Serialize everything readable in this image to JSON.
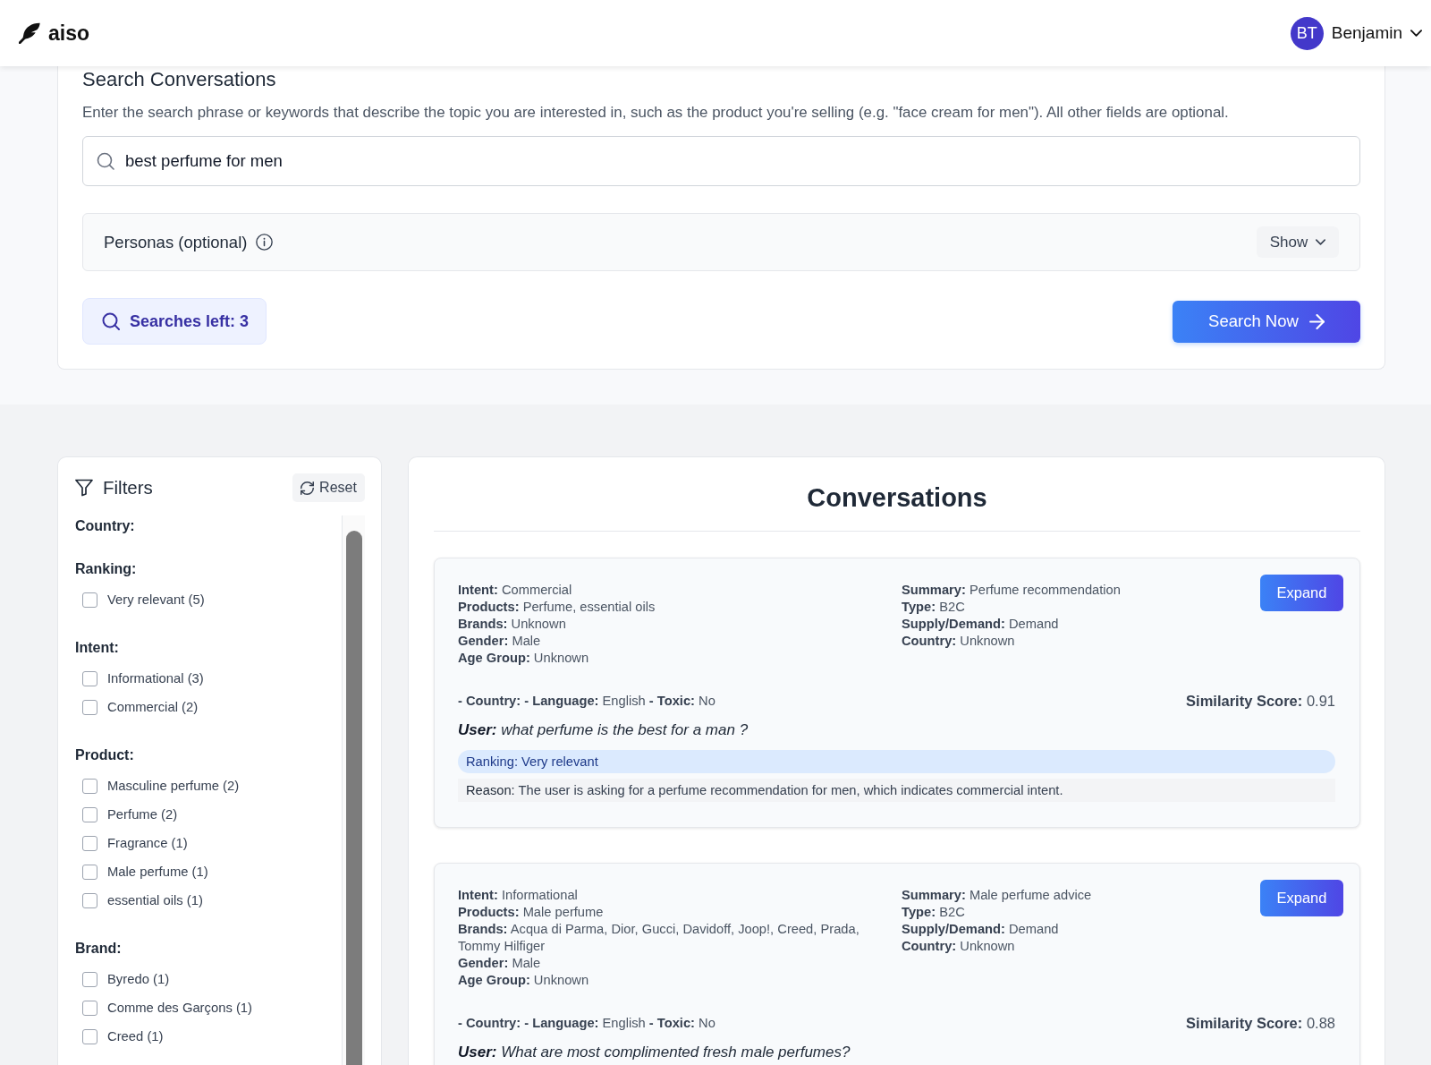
{
  "header": {
    "logo": "aiso",
    "user": {
      "initials": "BT",
      "name": "Benjamin"
    }
  },
  "search": {
    "title": "Search Conversations",
    "description": "Enter the search phrase or keywords that describe the topic you are interested in, such as the product you're selling (e.g. \"face cream for men\"). All other fields are optional.",
    "query": "best perfume for men",
    "personas": {
      "label": "Personas (optional)",
      "toggle": "Show",
      "expanded": false
    },
    "searches_left": "Searches left: 3",
    "submit": "Search Now"
  },
  "filters": {
    "title": "Filters",
    "reset": "Reset",
    "groups": [
      {
        "title": "Country:"
      },
      {
        "title": "Ranking:",
        "options": [
          {
            "label": "Very relevant (5)",
            "checked": false
          }
        ]
      },
      {
        "title": "Intent:",
        "options": [
          {
            "label": "Informational (3)",
            "checked": false
          },
          {
            "label": "Commercial (2)",
            "checked": false
          }
        ]
      },
      {
        "title": "Product:",
        "options": [
          {
            "label": "Masculine perfume (2)",
            "checked": false
          },
          {
            "label": "Perfume (2)",
            "checked": false
          },
          {
            "label": "Fragrance (1)",
            "checked": false
          },
          {
            "label": "Male perfume (1)",
            "checked": false
          },
          {
            "label": "essential oils (1)",
            "checked": false
          }
        ]
      },
      {
        "title": "Brand:",
        "options": [
          {
            "label": "Byredo (1)",
            "checked": false
          },
          {
            "label": "Comme des Garçons (1)",
            "checked": false
          },
          {
            "label": "Creed (1)",
            "checked": false
          }
        ]
      }
    ]
  },
  "conversations": {
    "title": "Conversations",
    "items": [
      {
        "details_left": [
          {
            "label": "Intent:",
            "value": "Commercial"
          },
          {
            "label": "Products:",
            "value": "Perfume, essential oils"
          },
          {
            "label": "Brands:",
            "value": "Unknown"
          },
          {
            "label": "Gender:",
            "value": "Male"
          },
          {
            "label": "Age Group:",
            "value": "Unknown"
          }
        ],
        "details_right": [
          {
            "label": "Summary:",
            "value": "Perfume recommendation"
          },
          {
            "label": "Type:",
            "value": "B2C"
          },
          {
            "label": "Supply/Demand:",
            "value": "Demand"
          },
          {
            "label": "Country:",
            "value": "Unknown"
          }
        ],
        "expand": "Expand",
        "meta": "**- Country: - Language:** English **- Toxic:** No",
        "similarity": {
          "label": "Similarity Score:",
          "value": "0.91"
        },
        "message": {
          "speaker": "User:",
          "text": "what perfume is the best for a man ?"
        },
        "ranking": "Ranking: Very relevant",
        "reason": {
          "label": "Reason:",
          "text": "The user is asking for a perfume recommendation for men, which indicates commercial intent."
        }
      },
      {
        "details_left": [
          {
            "label": "Intent:",
            "value": "Informational"
          },
          {
            "label": "Products:",
            "value": "Male perfume"
          },
          {
            "label": "Brands:",
            "value": "Acqua di Parma, Dior, Gucci, Davidoff, Joop!, Creed, Prada, Tommy Hilfiger"
          },
          {
            "label": "Gender:",
            "value": "Male"
          },
          {
            "label": "Age Group:",
            "value": "Unknown"
          }
        ],
        "details_right": [
          {
            "label": "Summary:",
            "value": "Male perfume advice"
          },
          {
            "label": "Type:",
            "value": "B2C"
          },
          {
            "label": "Supply/Demand:",
            "value": "Demand"
          },
          {
            "label": "Country:",
            "value": "Unknown"
          }
        ],
        "expand": "Expand",
        "meta": "**- Country: - Language:** English **- Toxic:** No",
        "similarity": {
          "label": "Similarity Score:",
          "value": "0.88"
        },
        "message": {
          "speaker": "User:",
          "text": "What are most complimented fresh male perfumes?"
        }
      }
    ]
  }
}
